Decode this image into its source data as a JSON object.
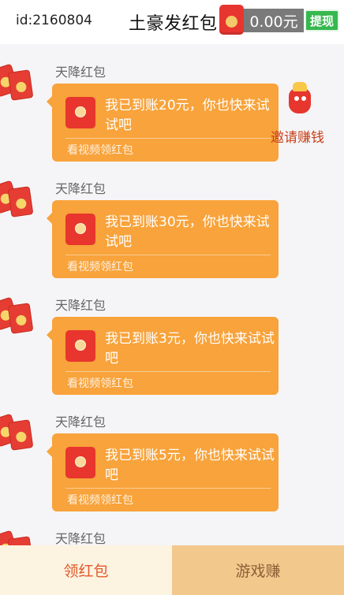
{
  "header": {
    "user_id": "id:2160804",
    "title": "土豪发红包",
    "balance": "0.00元",
    "withdraw_label": "提现"
  },
  "invite": {
    "label": "邀请赚钱"
  },
  "messages": [
    {
      "sender": "天降红包",
      "text": "我已到账20元，你也快来试试吧",
      "footer": "看视频领红包"
    },
    {
      "sender": "天降红包",
      "text": "我已到账30元，你也快来试试吧",
      "footer": "看视频领红包"
    },
    {
      "sender": "天降红包",
      "text": "我已到账3元，你也快来试试吧",
      "footer": "看视频领红包"
    },
    {
      "sender": "天降红包",
      "text": "我已到账5元，你也快来试试吧",
      "footer": "看视频领红包"
    },
    {
      "sender": "天降红包"
    }
  ],
  "bottom_tabs": [
    {
      "label": "领红包"
    },
    {
      "label": "游戏赚"
    }
  ],
  "colors": {
    "bubble": "#f8a33b",
    "packet_red": "#e7362f",
    "withdraw_green": "#36b84e",
    "tab_left_bg": "#fdf3e1",
    "tab_right_bg": "#f2c88d"
  }
}
